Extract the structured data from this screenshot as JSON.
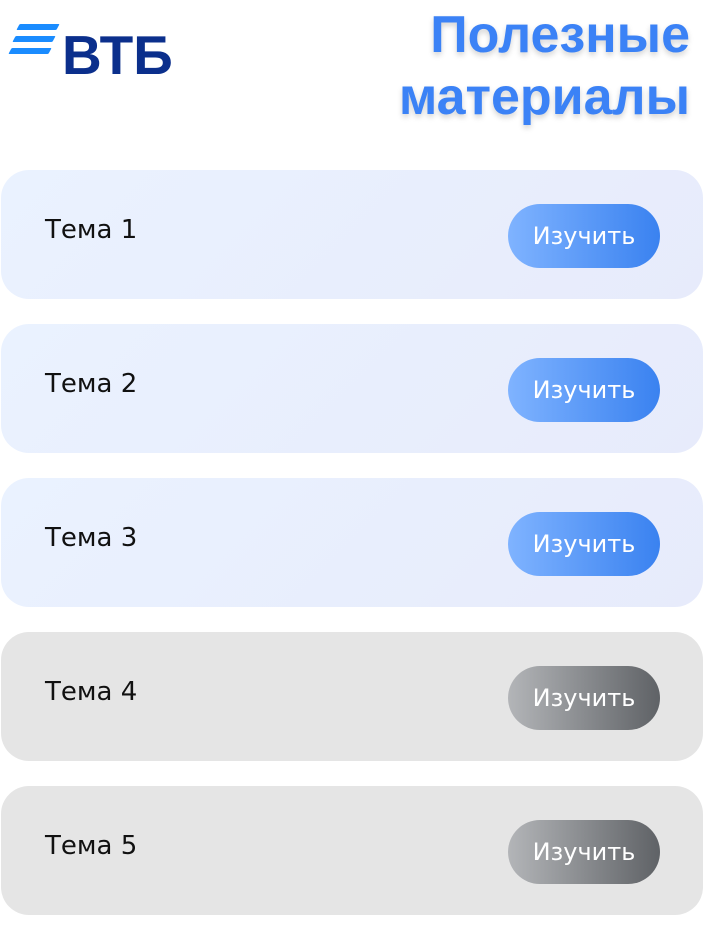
{
  "header": {
    "logo_text": "ВТБ",
    "title": "Полезные материалы"
  },
  "colors": {
    "title_blue": "#3b82f6",
    "logo_navy": "#0b2f8c",
    "logo_stripe_blue": "#1a8cff",
    "active_card": "#eaf2ff",
    "inactive_card": "#e5e5e5",
    "active_button": "#3a82f0",
    "inactive_button": "#5f6266"
  },
  "topics": [
    {
      "label": "Тема 1",
      "button": "Изучить",
      "state": "active"
    },
    {
      "label": "Тема 2",
      "button": "Изучить",
      "state": "active"
    },
    {
      "label": "Тема 3",
      "button": "Изучить",
      "state": "active"
    },
    {
      "label": "Тема 4",
      "button": "Изучить",
      "state": "inactive"
    },
    {
      "label": "Тема 5",
      "button": "Изучить",
      "state": "inactive"
    }
  ]
}
